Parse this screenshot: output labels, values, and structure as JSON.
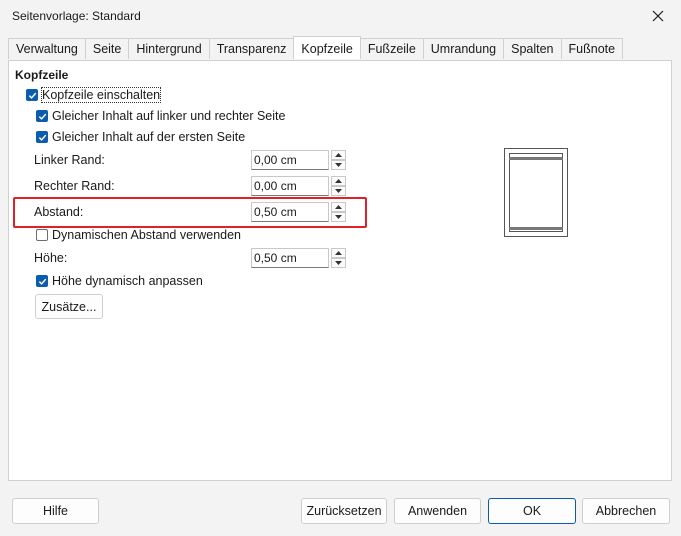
{
  "window": {
    "title": "Seitenvorlage: Standard"
  },
  "tabs": [
    "Verwaltung",
    "Seite",
    "Hintergrund",
    "Transparenz",
    "Kopfzeile",
    "Fußzeile",
    "Umrandung",
    "Spalten",
    "Fußnote"
  ],
  "active_tab": "Kopfzeile",
  "section": {
    "title": "Kopfzeile"
  },
  "checkboxes": {
    "enable_header": {
      "label": "Kopfzeile einschalten",
      "checked": true
    },
    "same_left_right": {
      "label": "Gleicher Inhalt auf linker und rechter Seite",
      "checked": true
    },
    "same_first_page": {
      "label": "Gleicher Inhalt auf der ersten Seite",
      "checked": true
    },
    "dynamic_spacing": {
      "label": "Dynamischen Abstand verwenden",
      "checked": false
    },
    "autofit_height": {
      "label": "Höhe dynamisch anpassen",
      "checked": true
    }
  },
  "fields": {
    "left_margin": {
      "label": "Linker Rand:",
      "value": "0,00 cm"
    },
    "right_margin": {
      "label": "Rechter Rand:",
      "value": "0,00 cm"
    },
    "spacing": {
      "label": "Abstand:",
      "value": "0,50 cm"
    },
    "height": {
      "label": "Höhe:",
      "value": "0,50 cm"
    }
  },
  "buttons": {
    "more": "Zusätze...",
    "help": "Hilfe",
    "reset": "Zurücksetzen",
    "apply": "Anwenden",
    "ok": "OK",
    "cancel": "Abbrechen"
  },
  "colors": {
    "accent": "#0b5cad",
    "highlight": "#e0202a"
  },
  "icons": {
    "close": "close-icon",
    "spin_up": "chevron-up-icon",
    "spin_down": "chevron-down-icon",
    "check": "check-icon"
  }
}
